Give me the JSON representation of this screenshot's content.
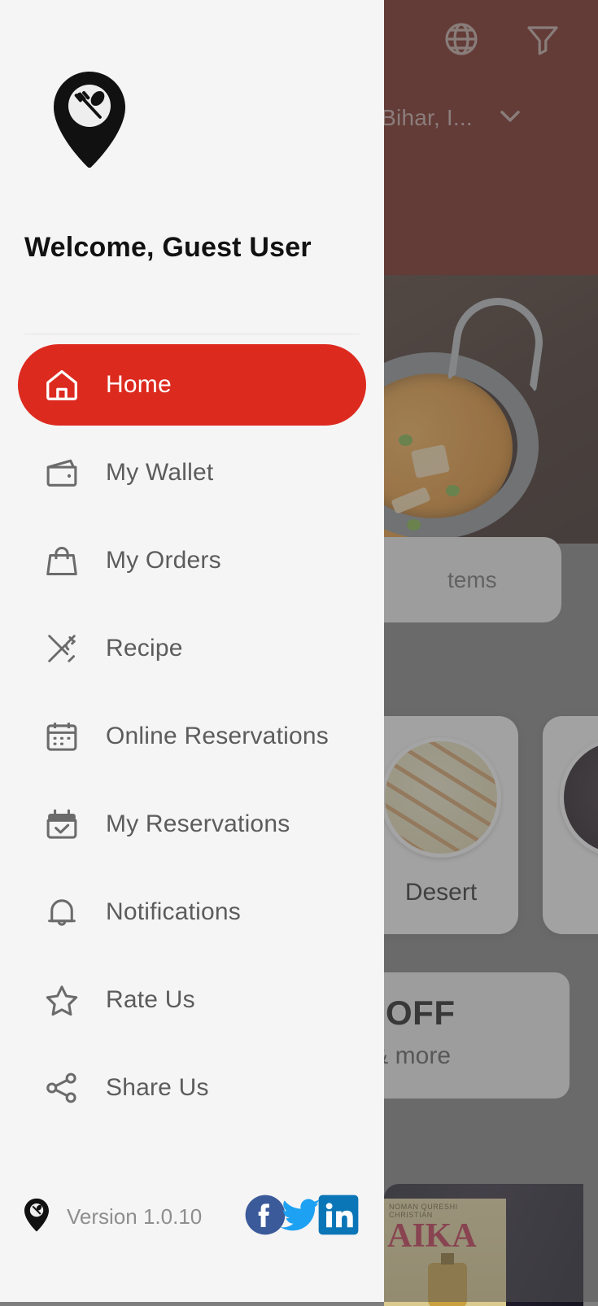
{
  "drawer": {
    "logo_icon": "location-pin-restaurant-logo",
    "welcome_text": "Welcome, Guest User",
    "menu_items": [
      {
        "label": "Home",
        "icon": "home-icon",
        "active": true
      },
      {
        "label": "My Wallet",
        "icon": "wallet-icon",
        "active": false
      },
      {
        "label": "My Orders",
        "icon": "handbag-icon",
        "active": false
      },
      {
        "label": "Recipe",
        "icon": "cutlery-icon",
        "active": false
      },
      {
        "label": "Online Reservations",
        "icon": "calendar-icon",
        "active": false
      },
      {
        "label": "My Reservations",
        "icon": "calendar-check-icon",
        "active": false
      },
      {
        "label": "Notifications",
        "icon": "bell-icon",
        "active": false
      },
      {
        "label": "Rate Us",
        "icon": "star-icon",
        "active": false
      },
      {
        "label": "Share Us",
        "icon": "share-icon",
        "active": false
      }
    ],
    "footer": {
      "pin_icon": "location-pin-icon",
      "version_text": "Version 1.0.10",
      "socials": [
        {
          "name": "facebook-icon",
          "color": "#3b5a9a"
        },
        {
          "name": "twitter-icon",
          "color": "#1da1f2"
        },
        {
          "name": "linkedin-icon",
          "color": "#0b76b7"
        }
      ]
    },
    "accent_color": "#dd2a1f",
    "background_color": "#f5f5f5"
  },
  "background_app": {
    "header": {
      "background_color": "#70170f",
      "globe_icon": "globe-icon",
      "filter_icon": "filter-funnel-icon",
      "location_text": "nj, Bihar, I...",
      "location_chevron_icon": "chevron-down-icon"
    },
    "hero_image_alt": "curry in a karahi pan",
    "search": {
      "text": "tems"
    },
    "categories": [
      {
        "label": "Desert",
        "thumb_alt": "sliced dessert on plate"
      },
      {
        "label": "",
        "thumb_alt": "dark dish"
      }
    ],
    "promo": {
      "headline": "% OFF",
      "subtext": "rs & more"
    },
    "bottom_card": {
      "poster_small_text": "NOMAN QURESHI   CHRISTIAN",
      "poster_title": "AIKA"
    },
    "scrim_color": "#7e7e7e"
  }
}
